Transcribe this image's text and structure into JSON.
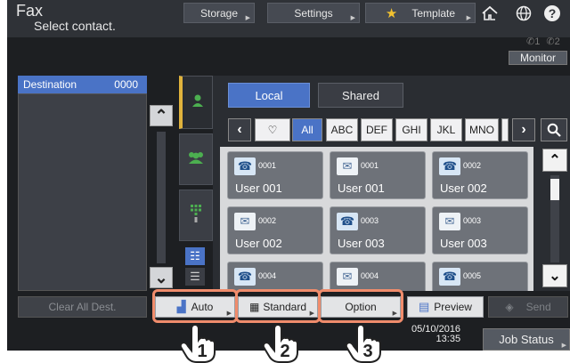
{
  "header": {
    "title": "Fax",
    "subtitle": "Select contact.",
    "storage_label": "Storage",
    "settings_label": "Settings",
    "template_label": "Template",
    "line1": "1",
    "line2": "2",
    "monitor_label": "Monitor"
  },
  "destination": {
    "label": "Destination",
    "count": "0000",
    "clear_label": "Clear All Dest."
  },
  "tabs": {
    "local": "Local",
    "shared": "Shared"
  },
  "index": [
    "All",
    "ABC",
    "DEF",
    "GHI",
    "JKL",
    "MNO"
  ],
  "contacts": [
    {
      "type": "fax",
      "num": "0001",
      "name": "User 001"
    },
    {
      "type": "mail",
      "num": "0001",
      "name": "User 001"
    },
    {
      "type": "fax",
      "num": "0002",
      "name": "User 002"
    },
    {
      "type": "mail",
      "num": "0002",
      "name": "User 002"
    },
    {
      "type": "fax",
      "num": "0003",
      "name": "User 003"
    },
    {
      "type": "mail",
      "num": "0003",
      "name": "User 003"
    },
    {
      "type": "fax",
      "num": "0004",
      "name": ""
    },
    {
      "type": "mail",
      "num": "0004",
      "name": ""
    },
    {
      "type": "fax",
      "num": "0005",
      "name": ""
    }
  ],
  "bottom": {
    "auto_label": "Auto",
    "standard_label": "Standard",
    "option_label": "Option",
    "preview_label": "Preview",
    "send_label": "Send",
    "date": "05/10/2016",
    "time": "13:35",
    "job_status_label": "Job Status"
  },
  "callouts": [
    "1",
    "2",
    "3"
  ],
  "colors": {
    "accent": "#4a73c6",
    "highlight": "#f08c6c",
    "active_tab": "#e0b33c"
  }
}
